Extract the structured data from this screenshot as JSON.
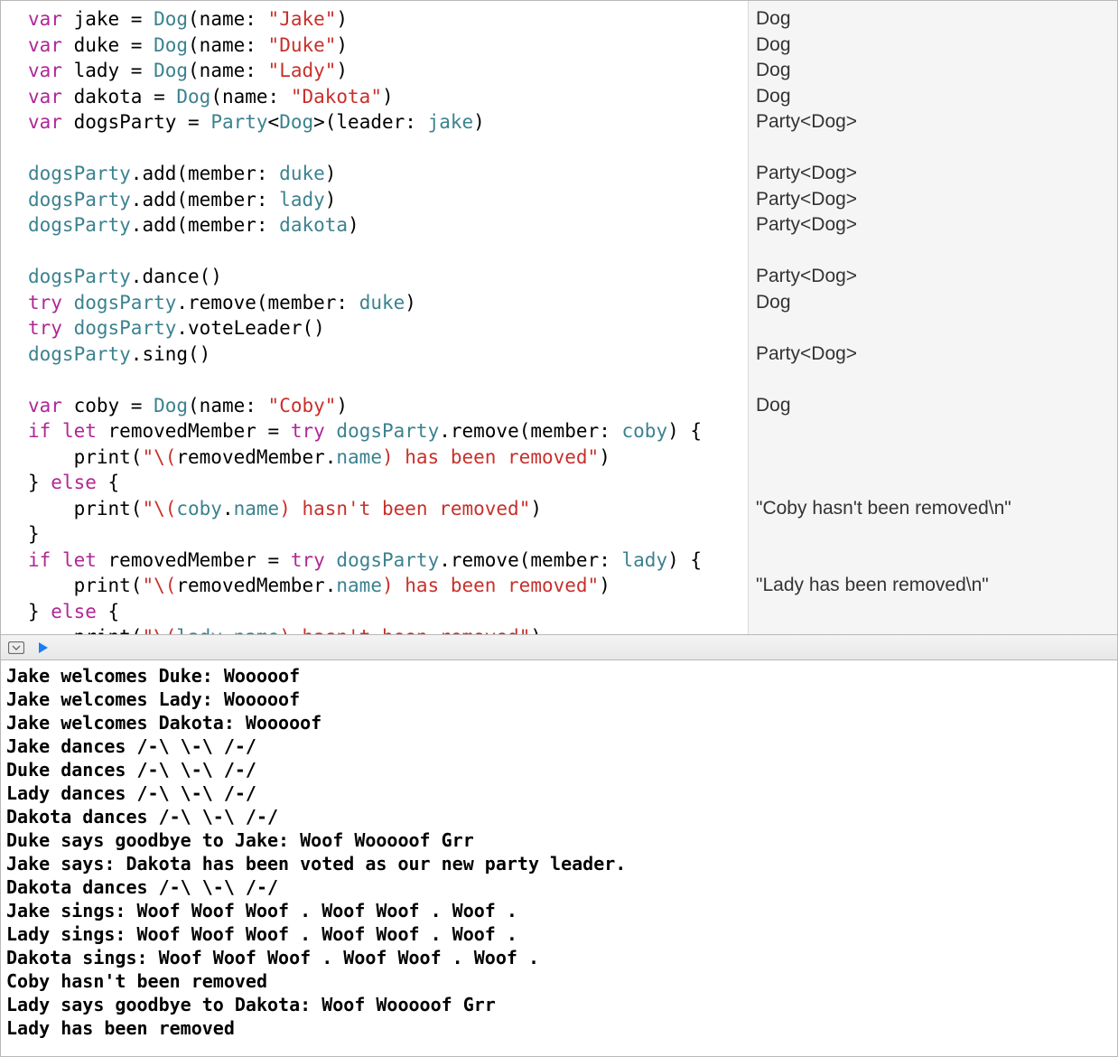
{
  "editor": {
    "lines": [
      [
        [
          "kw",
          "var"
        ],
        [
          "id",
          " jake = "
        ],
        [
          "type",
          "Dog"
        ],
        [
          "id",
          "(name: "
        ],
        [
          "str",
          "\"Jake\""
        ],
        [
          "id",
          ")"
        ]
      ],
      [
        [
          "kw",
          "var"
        ],
        [
          "id",
          " duke = "
        ],
        [
          "type",
          "Dog"
        ],
        [
          "id",
          "(name: "
        ],
        [
          "str",
          "\"Duke\""
        ],
        [
          "id",
          ")"
        ]
      ],
      [
        [
          "kw",
          "var"
        ],
        [
          "id",
          " lady = "
        ],
        [
          "type",
          "Dog"
        ],
        [
          "id",
          "(name: "
        ],
        [
          "str",
          "\"Lady\""
        ],
        [
          "id",
          ")"
        ]
      ],
      [
        [
          "kw",
          "var"
        ],
        [
          "id",
          " dakota = "
        ],
        [
          "type",
          "Dog"
        ],
        [
          "id",
          "(name: "
        ],
        [
          "str",
          "\"Dakota\""
        ],
        [
          "id",
          ")"
        ]
      ],
      [
        [
          "kw",
          "var"
        ],
        [
          "id",
          " dogsParty = "
        ],
        [
          "type",
          "Party"
        ],
        [
          "id",
          "<"
        ],
        [
          "type",
          "Dog"
        ],
        [
          "id",
          ">(leader: "
        ],
        [
          "type",
          "jake"
        ],
        [
          "id",
          ")"
        ]
      ],
      [
        [
          "id",
          ""
        ]
      ],
      [
        [
          "type",
          "dogsParty"
        ],
        [
          "id",
          ".add(member: "
        ],
        [
          "type",
          "duke"
        ],
        [
          "id",
          ")"
        ]
      ],
      [
        [
          "type",
          "dogsParty"
        ],
        [
          "id",
          ".add(member: "
        ],
        [
          "type",
          "lady"
        ],
        [
          "id",
          ")"
        ]
      ],
      [
        [
          "type",
          "dogsParty"
        ],
        [
          "id",
          ".add(member: "
        ],
        [
          "type",
          "dakota"
        ],
        [
          "id",
          ")"
        ]
      ],
      [
        [
          "id",
          ""
        ]
      ],
      [
        [
          "type",
          "dogsParty"
        ],
        [
          "id",
          ".dance()"
        ]
      ],
      [
        [
          "kw",
          "try"
        ],
        [
          "id",
          " "
        ],
        [
          "type",
          "dogsParty"
        ],
        [
          "id",
          ".remove(member: "
        ],
        [
          "type",
          "duke"
        ],
        [
          "id",
          ")"
        ]
      ],
      [
        [
          "kw",
          "try"
        ],
        [
          "id",
          " "
        ],
        [
          "type",
          "dogsParty"
        ],
        [
          "id",
          ".voteLeader()"
        ]
      ],
      [
        [
          "type",
          "dogsParty"
        ],
        [
          "id",
          ".sing()"
        ]
      ],
      [
        [
          "id",
          ""
        ]
      ],
      [
        [
          "kw",
          "var"
        ],
        [
          "id",
          " coby = "
        ],
        [
          "type",
          "Dog"
        ],
        [
          "id",
          "(name: "
        ],
        [
          "str",
          "\"Coby\""
        ],
        [
          "id",
          ")"
        ]
      ],
      [
        [
          "kw",
          "if"
        ],
        [
          "id",
          " "
        ],
        [
          "kw",
          "let"
        ],
        [
          "id",
          " removedMember = "
        ],
        [
          "kw",
          "try"
        ],
        [
          "id",
          " "
        ],
        [
          "type",
          "dogsParty"
        ],
        [
          "id",
          ".remove(member: "
        ],
        [
          "type",
          "coby"
        ],
        [
          "id",
          ") {"
        ]
      ],
      [
        [
          "id",
          "    print("
        ],
        [
          "str",
          "\"\\("
        ],
        [
          "id",
          "removedMember."
        ],
        [
          "type",
          "name"
        ],
        [
          "str",
          ") has been removed\""
        ],
        [
          "id",
          ")"
        ]
      ],
      [
        [
          "id",
          "} "
        ],
        [
          "kw",
          "else"
        ],
        [
          "id",
          " {"
        ]
      ],
      [
        [
          "id",
          "    print("
        ],
        [
          "str",
          "\"\\("
        ],
        [
          "type",
          "coby"
        ],
        [
          "id",
          "."
        ],
        [
          "type",
          "name"
        ],
        [
          "str",
          ") hasn't been removed\""
        ],
        [
          "id",
          ")"
        ]
      ],
      [
        [
          "id",
          "}"
        ]
      ],
      [
        [
          "kw",
          "if"
        ],
        [
          "id",
          " "
        ],
        [
          "kw",
          "let"
        ],
        [
          "id",
          " removedMember = "
        ],
        [
          "kw",
          "try"
        ],
        [
          "id",
          " "
        ],
        [
          "type",
          "dogsParty"
        ],
        [
          "id",
          ".remove(member: "
        ],
        [
          "type",
          "lady"
        ],
        [
          "id",
          ") {"
        ]
      ],
      [
        [
          "id",
          "    print("
        ],
        [
          "str",
          "\"\\("
        ],
        [
          "id",
          "removedMember."
        ],
        [
          "type",
          "name"
        ],
        [
          "str",
          ") has been removed\""
        ],
        [
          "id",
          ")"
        ]
      ],
      [
        [
          "id",
          "} "
        ],
        [
          "kw",
          "else"
        ],
        [
          "id",
          " {"
        ]
      ],
      [
        [
          "id",
          "    print("
        ],
        [
          "str",
          "\"\\("
        ],
        [
          "type",
          "lady"
        ],
        [
          "id",
          "."
        ],
        [
          "type",
          "name"
        ],
        [
          "str",
          ") hasn't been removed\""
        ],
        [
          "id",
          ")"
        ]
      ],
      [
        [
          "id",
          "}"
        ]
      ]
    ]
  },
  "sidebar": {
    "results": [
      "Dog",
      "Dog",
      "Dog",
      "Dog",
      "Party<Dog>",
      "",
      "Party<Dog>",
      "Party<Dog>",
      "Party<Dog>",
      "",
      "Party<Dog>",
      "Dog",
      "",
      "Party<Dog>",
      "",
      "Dog",
      "",
      "",
      "",
      "\"Coby hasn't been removed\\n\"",
      "",
      "",
      "\"Lady has been removed\\n\"",
      "",
      "",
      ""
    ]
  },
  "console": {
    "lines": [
      "Jake welcomes Duke: Wooooof",
      "Jake welcomes Lady: Wooooof",
      "Jake welcomes Dakota: Wooooof",
      "Jake dances /-\\ \\-\\ /-/",
      "Duke dances /-\\ \\-\\ /-/",
      "Lady dances /-\\ \\-\\ /-/",
      "Dakota dances /-\\ \\-\\ /-/",
      "Duke says goodbye to Jake: Woof Wooooof Grr",
      "Jake says: Dakota has been voted as our new party leader.",
      "Dakota dances /-\\ \\-\\ /-/",
      "Jake sings: Woof Woof Woof . Woof Woof . Woof .",
      "Lady sings: Woof Woof Woof . Woof Woof . Woof .",
      "Dakota sings: Woof Woof Woof . Woof Woof . Woof .",
      "Coby hasn't been removed",
      "Lady says goodbye to Dakota: Woof Wooooof Grr",
      "Lady has been removed"
    ]
  }
}
